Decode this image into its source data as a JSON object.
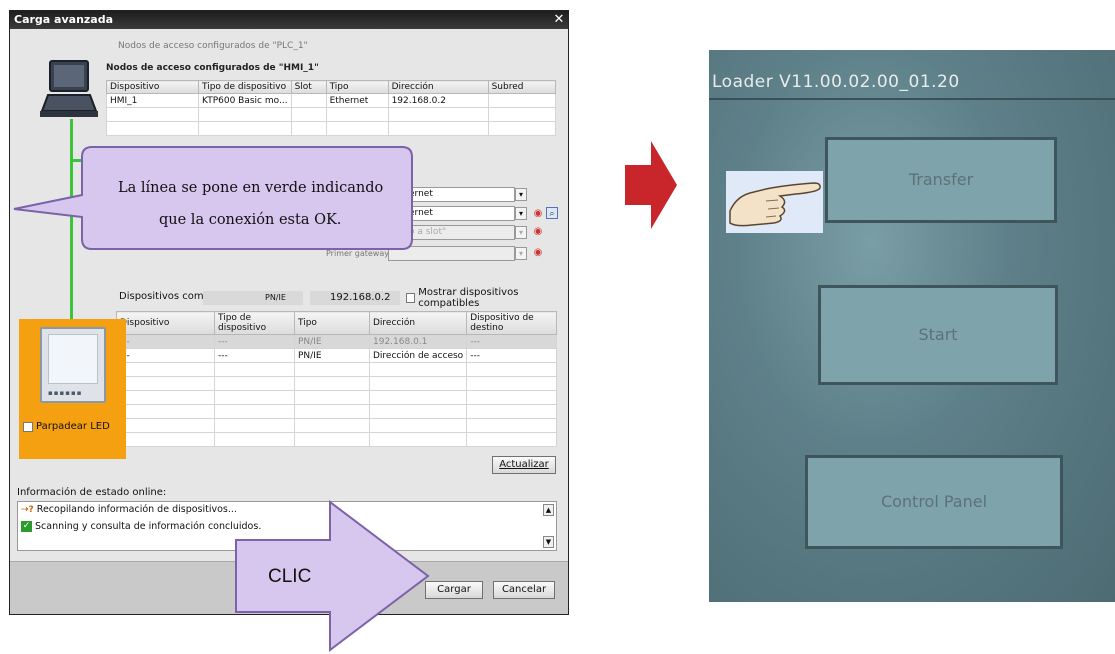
{
  "dialog": {
    "title": "Carga avanzada",
    "faded_heading": "Nodos de acceso configurados de \"PLC_1\"",
    "configured_heading": "Nodos de acceso configurados de \"HMI_1\"",
    "config_table": {
      "headers": [
        "Dispositivo",
        "Tipo de dispositivo",
        "Slot",
        "Tipo",
        "Dirección",
        "Subred"
      ],
      "rows": [
        [
          "HMI_1",
          "KTP600 Basic mo...",
          "",
          "Ethernet",
          "192.168.0.2",
          ""
        ],
        [
          "",
          "",
          "",
          "",
          "",
          ""
        ],
        [
          "",
          "",
          "",
          "",
          "",
          ""
        ]
      ]
    },
    "dropdowns": {
      "iface_type": "ernet",
      "iface_name": "ernet",
      "slot": "o a slot\"",
      "gateway_label": "Primer gateway:"
    },
    "compatible": {
      "label": "Dispositivos compa",
      "type_value": "PN/IE",
      "address_value": "192.168.0.2",
      "show_compatible_label": "Mostrar dispositivos compatibles"
    },
    "device_table": {
      "headers": [
        "Dispositivo",
        "Tipo de dispositivo",
        "Tipo",
        "Dirección",
        "Dispositivo de destino"
      ],
      "rows": [
        [
          "---",
          "---",
          "PN/IE",
          "192.168.0.1",
          "---"
        ],
        [
          "---",
          "---",
          "PN/IE",
          "Dirección de acceso",
          "---"
        ],
        [
          "",
          "",
          "",
          "",
          ""
        ],
        [
          "",
          "",
          "",
          "",
          ""
        ],
        [
          "",
          "",
          "",
          "",
          ""
        ],
        [
          "",
          "",
          "",
          "",
          ""
        ],
        [
          "",
          "",
          "",
          "",
          ""
        ],
        [
          "",
          "",
          "",
          "",
          ""
        ]
      ]
    },
    "led_label": "Parpadear LED",
    "refresh_label": "Actualizar",
    "status_heading": "Información de estado online:",
    "status_lines": [
      {
        "icon": "question-icon",
        "text": "Recopilando información de dispositivos..."
      },
      {
        "icon": "check-icon",
        "text": "Scanning y consulta de información concluidos."
      }
    ],
    "load_label": "Cargar",
    "cancel_label": "Cancelar"
  },
  "callouts": {
    "line1": "La línea se pone en verde indicando",
    "line2": "que la conexión esta OK.",
    "clic": "CLIC"
  },
  "photo": {
    "title": "Loader V11.00.02.00_01.20",
    "buttons": [
      "Transfer",
      "Start",
      "Control Panel"
    ]
  },
  "colors": {
    "green_line": "#39c43b",
    "hmi_panel": "#f5a011",
    "callout_fill": "#d7c6ee",
    "callout_border": "#7a63a8",
    "red_arrow": "#c8262b"
  }
}
